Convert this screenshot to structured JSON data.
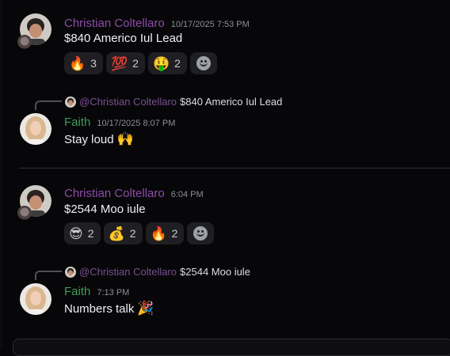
{
  "messages": [
    {
      "author": "Christian Coltellaro",
      "timestamp": "10/17/2025 7:53 PM",
      "text": "$840 Americo Iul Lead",
      "reactions": [
        {
          "emoji": "🔥",
          "count": "3"
        },
        {
          "emoji": "💯",
          "count": "2"
        },
        {
          "emoji": "🤑",
          "count": "2"
        }
      ]
    },
    {
      "reply_to": {
        "author": "@Christian Coltellaro",
        "text": "$840 Americo Iul Lead"
      },
      "author": "Faith",
      "timestamp": "10/17/2025 8:07 PM",
      "text": "Stay loud",
      "emoji": "🙌"
    },
    {
      "author": "Christian Coltellaro",
      "timestamp": "6:04 PM",
      "text": "$2544 Moo iule",
      "reactions": [
        {
          "emoji": "😎",
          "count": "2"
        },
        {
          "emoji": "💰",
          "count": "2"
        },
        {
          "emoji": "🔥",
          "count": "2"
        }
      ]
    },
    {
      "reply_to": {
        "author": "@Christian Coltellaro",
        "text": "$2544 Moo iule"
      },
      "author": "Faith",
      "timestamp": "7:13 PM",
      "text": "Numbers talk",
      "emoji": "🎉"
    }
  ],
  "colors": {
    "background": "#070709",
    "christian_name": "#8d4ca8",
    "faith_name": "#3f9b55",
    "reaction_bg": "#1f1f23"
  },
  "icons": {
    "add_reaction": "smiley-icon",
    "avatar_decoration": "badge-icon"
  }
}
